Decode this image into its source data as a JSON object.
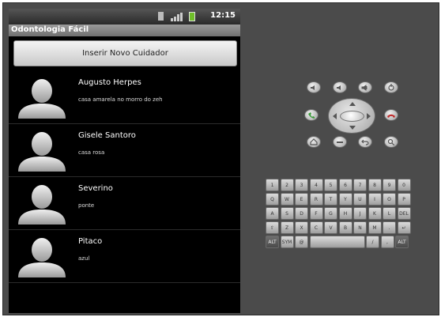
{
  "status_bar": {
    "time": "12:15"
  },
  "app": {
    "title": "Odontologia Fácil"
  },
  "insert_button": {
    "label": "Inserir Novo Cuidador"
  },
  "contacts": [
    {
      "name": "Augusto Herpes",
      "description": "casa amarela no morro do zeh"
    },
    {
      "name": "Gisele Santoro",
      "description": "casa rosa"
    },
    {
      "name": "Severino",
      "description": "ponte"
    },
    {
      "name": "Pitaco",
      "description": "azul"
    }
  ],
  "keyboard": {
    "rows": [
      [
        "1",
        "2",
        "3",
        "4",
        "5",
        "6",
        "7",
        "8",
        "9",
        "0"
      ],
      [
        "Q",
        "W",
        "E",
        "R",
        "T",
        "Y",
        "U",
        "I",
        "O",
        "P"
      ],
      [
        "A",
        "S",
        "D",
        "F",
        "G",
        "H",
        "J",
        "K",
        "L",
        "DEL"
      ],
      [
        "⇧",
        "Z",
        "X",
        "C",
        "V",
        "B",
        "N",
        "M",
        ".",
        "↵"
      ]
    ],
    "bottom_row": [
      "ALT",
      "SYM",
      "@",
      "",
      "/",
      ",",
      "ALT"
    ]
  },
  "icons": {
    "home": "home-icon",
    "menu": "menu-icon",
    "back": "back-icon",
    "search": "search-icon",
    "call": "call-icon",
    "end_call": "end-call-icon"
  },
  "colors": {
    "call": "#3a9a3a",
    "end_call": "#c03030",
    "battery": "#6fbf2a"
  }
}
